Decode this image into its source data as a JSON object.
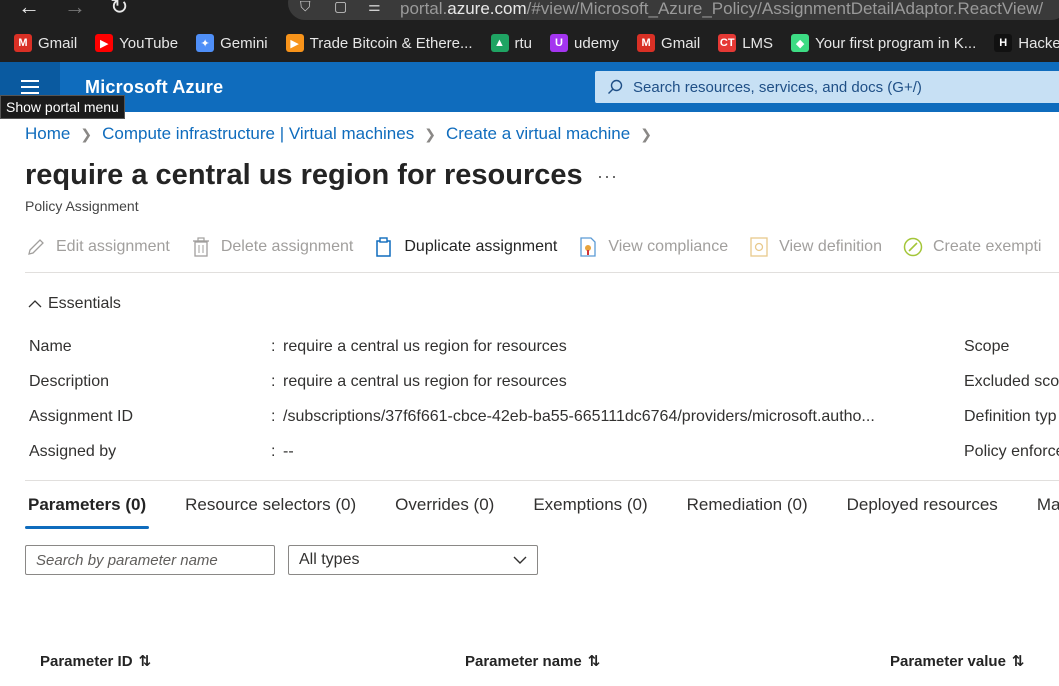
{
  "browser": {
    "url_prefix": "portal.",
    "url_domain": "azure.com",
    "url_path": "/#view/Microsoft_Azure_Policy/AssignmentDetailAdaptor.ReactView/",
    "bookmarks": [
      {
        "label": "Gmail",
        "icon": "gmail-icon",
        "color": "#d93025",
        "glyph": "M"
      },
      {
        "label": "YouTube",
        "icon": "youtube-icon",
        "color": "#ff0000",
        "glyph": "▶"
      },
      {
        "label": "Gemini",
        "icon": "gemini-icon",
        "color": "#4f8ff7",
        "glyph": "✦"
      },
      {
        "label": "Trade Bitcoin & Ethere...",
        "icon": "trade-icon",
        "color": "#f7931a",
        "glyph": "▶"
      },
      {
        "label": "rtu",
        "icon": "drive-icon",
        "color": "#1fa463",
        "glyph": "▲"
      },
      {
        "label": "udemy",
        "icon": "udemy-icon",
        "color": "#a435f0",
        "glyph": "U"
      },
      {
        "label": "Gmail",
        "icon": "gmail-icon",
        "color": "#d93025",
        "glyph": "M"
      },
      {
        "label": "LMS",
        "icon": "lms-icon",
        "color": "#e53935",
        "glyph": "CT"
      },
      {
        "label": "Your first program in K...",
        "icon": "android-icon",
        "color": "#3ddc84",
        "glyph": "◆"
      },
      {
        "label": "HackerRan",
        "icon": "hackerrank-icon",
        "color": "#111111",
        "glyph": "H"
      }
    ]
  },
  "header": {
    "brand": "Microsoft Azure",
    "search_placeholder": "Search resources, services, and docs (G+/)",
    "menu_tooltip": "Show portal menu"
  },
  "breadcrumb": [
    "Home",
    "Compute infrastructure | Virtual machines",
    "Create a virtual machine"
  ],
  "page": {
    "title": "require a central us region for resources",
    "subtitle": "Policy Assignment",
    "more": "···"
  },
  "toolbar": [
    {
      "label": "Edit assignment",
      "icon": "pencil-icon",
      "enabled": false
    },
    {
      "label": "Delete assignment",
      "icon": "trash-icon",
      "enabled": false
    },
    {
      "label": "Duplicate assignment",
      "icon": "duplicate-icon",
      "enabled": true
    },
    {
      "label": "View compliance",
      "icon": "compliance-icon",
      "enabled": false
    },
    {
      "label": "View definition",
      "icon": "definition-icon",
      "enabled": false
    },
    {
      "label": "Create exempti",
      "icon": "exemption-icon",
      "enabled": false
    }
  ],
  "essentials": {
    "title": "Essentials",
    "rows": [
      {
        "label": "Name",
        "value": "require a central us region for resources"
      },
      {
        "label": "Description",
        "value": "require a central us region for resources"
      },
      {
        "label": "Assignment ID",
        "value": "/subscriptions/37f6f661-cbce-42eb-ba55-665111dc6764/providers/microsoft.autho..."
      },
      {
        "label": "Assigned by",
        "value": "--"
      }
    ],
    "right_labels": [
      "Scope",
      "Excluded scop",
      "Definition typ",
      "Policy enforce"
    ]
  },
  "tabs": [
    {
      "label": "Parameters (0)",
      "selected": true
    },
    {
      "label": "Resource selectors (0)",
      "selected": false
    },
    {
      "label": "Overrides (0)",
      "selected": false
    },
    {
      "label": "Exemptions (0)",
      "selected": false
    },
    {
      "label": "Remediation (0)",
      "selected": false
    },
    {
      "label": "Deployed resources",
      "selected": false
    },
    {
      "label": "Ma",
      "selected": false
    }
  ],
  "filters": {
    "search_placeholder": "Search by parameter name",
    "type_value": "All types"
  },
  "table": {
    "columns": [
      "Parameter ID",
      "Parameter name",
      "Parameter value"
    ]
  }
}
